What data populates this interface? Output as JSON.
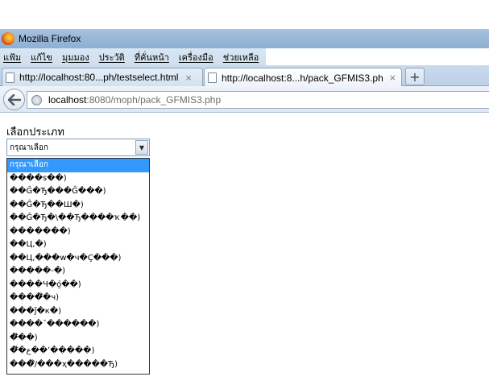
{
  "window": {
    "title": "Mozilla Firefox"
  },
  "menu": [
    "แฟ้ม",
    "แก้ไข",
    "มุมมอง",
    "ประวัติ",
    "ที่คั่นหน้า",
    "เครื่องมือ",
    "ช่วยเหลือ"
  ],
  "tabs": [
    {
      "label": "http://localhost:80...ph/testselect.html",
      "close": "×"
    },
    {
      "label": "http://localhost:8...h/pack_GFMIS3.php",
      "close": "×"
    }
  ],
  "new_tab": "+",
  "address": {
    "host": "localhost",
    "rest": ":8080/moph/pack_GFMIS3.php"
  },
  "page": {
    "heading": "เลือกประเภท",
    "select_value": "กรุณาเลือก",
    "options": [
      "กรุณาเลือก",
      "����ѕ��)",
      "��Ĝ�Ђ���Ĝ���)",
      "��Ĝ�Ђ��Ш�)",
      "��Ĝ�Ђ�\\��Ђ����ҡ��)",
      "�������)",
      "��Ц,�)",
      "��Ц,���w�ч�Ç���)",
      "�����-�)",
      "����Ч�ó̱��)",
      "����໊�ч)",
      "���ǰ�к�)",
      "����¯������)",
      "�໊��)",
      "�໊�ع��ʼ�����)",
      "���໊/���ҳ�����Ђ)"
    ]
  }
}
